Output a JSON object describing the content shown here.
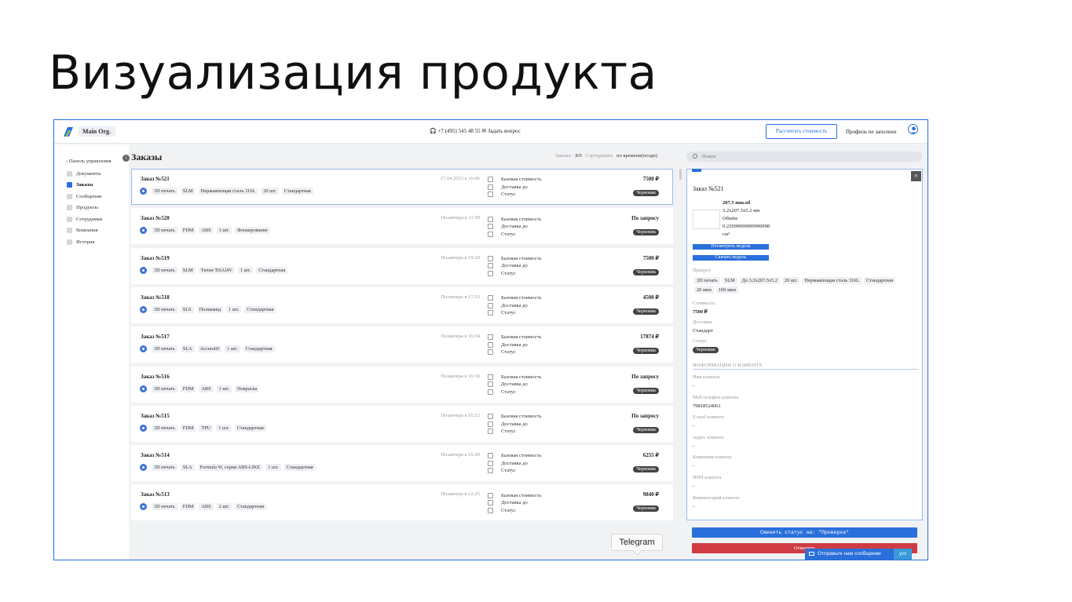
{
  "slide": {
    "title": "Визуализация продукта"
  },
  "topbar": {
    "org": "Main Org.",
    "contact": "🎧 +7 (495) 545 48 55 ✉ Задать вопрос",
    "calc_button": "Рассчитать стоимость",
    "profile": "Профиль не заполнен"
  },
  "sidebar": {
    "back": "‹ Панель управления",
    "items": [
      {
        "label": "Документы"
      },
      {
        "label": "Заказы"
      },
      {
        "label": "Сообщения"
      },
      {
        "label": "Продукты"
      },
      {
        "label": "Сотрудники"
      },
      {
        "label": "Компания"
      },
      {
        "label": "История"
      }
    ]
  },
  "orders": {
    "title": "Заказы",
    "sort_hint": "Заказы:",
    "sort_count": "8/9",
    "sort_label": "Сортировать",
    "sort_value": "по времени(поздн)",
    "search_placeholder": "Поиск",
    "field_labels": {
      "base": "Базовая стоимость",
      "delivery": "Доставка до",
      "status": "Статус"
    },
    "items": [
      {
        "number": "Заказ №521",
        "date": "27.04.2023 в 16:46",
        "tags": [
          "3D печать",
          "SLM",
          "Нержавеющая сталь 316L",
          "20 шт.",
          "Стандартная"
        ],
        "price": "7500 ₽",
        "status": "Черновик"
      },
      {
        "number": "Заказ №520",
        "date": "Позавчера в 11:58",
        "tags": [
          "3D печать",
          "FDM",
          "ABS",
          "1 шт.",
          "Флокирование"
        ],
        "price": "По запросу",
        "status": "Черновик"
      },
      {
        "number": "Заказ №519",
        "date": "Позавчера в 19:20",
        "tags": [
          "3D печать",
          "SLM",
          "Титан Ti6Al4V",
          "1 шт.",
          "Стандартная"
        ],
        "price": "7500 ₽",
        "status": "Черновик"
      },
      {
        "number": "Заказ №518",
        "date": "Позавчера в 17:53",
        "tags": [
          "3D печать",
          "SLS",
          "Полиамид",
          "1 шт.",
          "Стандартная"
        ],
        "price": "4500 ₽",
        "status": "Черновик"
      },
      {
        "number": "Заказ №517",
        "date": "Позавчера в 16:34",
        "tags": [
          "3D печать",
          "SLA",
          "Accura60",
          "1 шт.",
          "Стандартная"
        ],
        "price": "17874 ₽",
        "status": "Черновик"
      },
      {
        "number": "Заказ №516",
        "date": "Позавчера в 16:30",
        "tags": [
          "3D печать",
          "FDM",
          "ABS",
          "1 шт.",
          "Покраска"
        ],
        "price": "По запросу",
        "status": "Черновик"
      },
      {
        "number": "Заказ №515",
        "date": "Позавчера в 16:22",
        "tags": [
          "3D печать",
          "FDM",
          "TPU",
          "1 шт.",
          "Стандартная"
        ],
        "price": "По запросу",
        "status": "Черновик"
      },
      {
        "number": "Заказ №514",
        "date": "Позавчера в 16:20",
        "tags": [
          "3D печать",
          "SLA",
          "Formula W, серия ABS-LIKE",
          "1 шт.",
          "Стандартная"
        ],
        "price": "6255 ₽",
        "status": "Черновик"
      },
      {
        "number": "Заказ №513",
        "date": "Позавчера в 12:25",
        "tags": [
          "3D печать",
          "FDM",
          "ABS",
          "2 шт.",
          "Стандартная"
        ],
        "price": "9840 ₽",
        "status": "Черновик"
      }
    ]
  },
  "detail": {
    "title": "Заказ №521",
    "close": "×",
    "file_name": "207.5 mm.stl",
    "file_dims": "3.2x207.5x5.2 мм",
    "file_volume_label": "Объём:",
    "file_volume_value": "0.22999999999999998",
    "file_volume_unit": "см³",
    "view_model_button": "Посмотреть модель",
    "download_model_button": "Скачать модель",
    "product_label": "Продукт",
    "product_tags": [
      "3D печать",
      "SLM",
      "До 3.2x207.5x5.2",
      "20 шт.",
      "Нержавеющая сталь 316L",
      "Стандартная",
      "20 мкм",
      "100 мкм"
    ],
    "cost_label": "Стоимость",
    "cost_value": "7500 ₽",
    "delivery_label": "Доставка",
    "delivery_value": "Стандарт",
    "status_label": "Статус",
    "status_value": "Черновик",
    "client_section": "ИНФОРМАЦИЯ О КЛИЕНТЕ",
    "client_fields": [
      {
        "label": "Имя клиента",
        "value": "-"
      },
      {
        "label": "Моб.телефон клиента",
        "value": "79818524061"
      },
      {
        "label": "E-mail клиента",
        "value": "-"
      },
      {
        "label": "Адрес клиента",
        "value": "-"
      },
      {
        "label": "Компания клиента",
        "value": "-"
      },
      {
        "label": "ИНН клиента",
        "value": "-"
      },
      {
        "label": "Комментарий клиента",
        "value": "-"
      }
    ],
    "change_status_button": "Сменить статус на: \"Проверка\"",
    "cancel_button": "Отменить"
  },
  "chat": {
    "label": "Отправьте нам сообщение",
    "badge": "yvo"
  },
  "tooltip": {
    "label": "Telegram"
  },
  "colors": {
    "accent": "#2a6fdb",
    "danger": "#cf3c44",
    "badge_dark": "#444444"
  }
}
